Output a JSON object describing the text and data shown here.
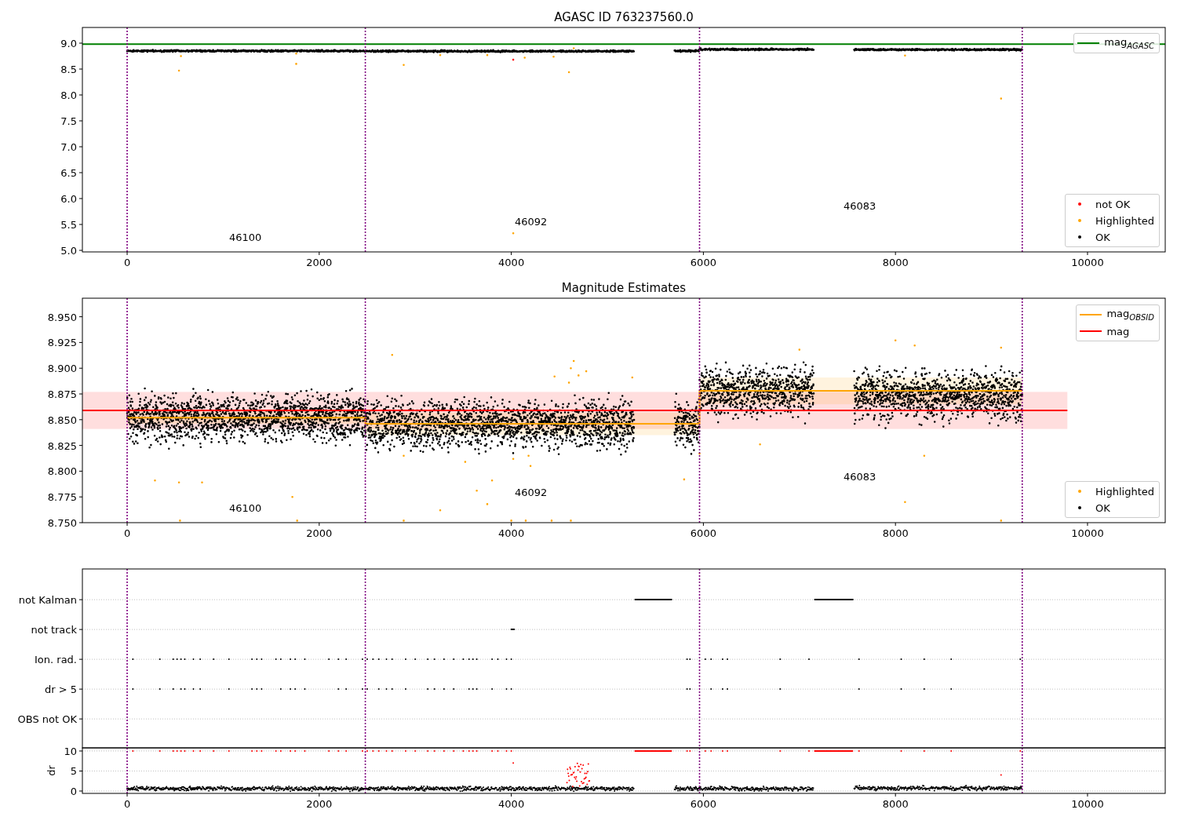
{
  "figure": {
    "panels": [
      {
        "kind": "mag",
        "chart_data": {
          "type": "line",
          "title": "AGASC ID 763237560.0",
          "x": [
            -466,
            10809
          ],
          "xlim": [
            -466,
            10809
          ],
          "ylim": [
            4.97,
            9.303
          ],
          "xticks": [
            0,
            2000,
            4000,
            6000,
            8000,
            10000
          ],
          "yticks": [
            {
              "value": 5,
              "label": "5.0"
            },
            {
              "value": 5.5,
              "label": "5.5"
            },
            {
              "value": 6,
              "label": "6.0"
            },
            {
              "value": 6.5,
              "label": "6.5"
            },
            {
              "value": 7,
              "label": "7.0"
            },
            {
              "value": 7.5,
              "label": "7.5"
            },
            {
              "value": 8,
              "label": "8.0"
            },
            {
              "value": 8.5,
              "label": "8.5"
            },
            {
              "value": 9,
              "label": "9.0"
            }
          ],
          "series": [
            {
              "name": "mag$_{AGASC}$",
              "color": "#008000",
              "values": [
                8.98,
                8.98
              ]
            }
          ],
          "ref_lines": [
            {
              "axis": "x",
              "value": 0
            },
            {
              "axis": "x",
              "value": 2480
            },
            {
              "axis": "x",
              "value": 5960
            },
            {
              "axis": "x",
              "value": 9320
            }
          ],
          "annotations": [
            {
              "text": "46100"
            },
            {
              "text": "46092"
            },
            {
              "text": "46083"
            }
          ]
        },
        "legends": [
          {
            "entries": [
              {
                "label": "not OK",
                "kind": "dot",
                "color": "#ff0000"
              },
              {
                "label": "Highlighted",
                "kind": "dot",
                "color": "#ffa500"
              },
              {
                "label": "OK",
                "kind": "dot",
                "color": "#000000"
              }
            ]
          }
        ]
      },
      {
        "kind": "mag",
        "chart_data": {
          "type": "line",
          "title": "Magnitude Estimates",
          "x": [
            -466,
            0,
            2480,
            2480,
            5960,
            5960,
            9320,
            9790
          ],
          "xlim": [
            -466,
            10809
          ],
          "ylim": [
            8.75,
            8.968
          ],
          "xticks": [
            0,
            2000,
            4000,
            6000,
            8000,
            10000
          ],
          "yticks": [
            {
              "value": 8.75,
              "label": "8.750"
            },
            {
              "value": 8.775,
              "label": "8.775"
            },
            {
              "value": 8.8,
              "label": "8.800"
            },
            {
              "value": 8.825,
              "label": "8.825"
            },
            {
              "value": 8.85,
              "label": "8.850"
            },
            {
              "value": 8.875,
              "label": "8.875"
            },
            {
              "value": 8.9,
              "label": "8.900"
            },
            {
              "value": 8.925,
              "label": "8.925"
            },
            {
              "value": 8.95,
              "label": "8.950"
            }
          ],
          "series": [
            {
              "name": "mag$_{OBSID}$",
              "color": "#ffa500",
              "values": [
                null,
                8.852,
                8.852,
                8.846,
                8.846,
                8.878,
                8.878,
                null
              ]
            },
            {
              "name": "mag",
              "color": "#ff0000",
              "values": [
                8.859,
                8.859,
                8.859,
                8.859,
                8.859,
                8.859,
                8.859,
                8.859
              ]
            }
          ],
          "bands": [
            {
              "axis": "y",
              "from": 8.841,
              "to": 8.877,
              "color": "#ff0000"
            },
            {
              "axis": "y",
              "from": 8.846,
              "to": 8.858,
              "color": "#ffa500"
            },
            {
              "axis": "y",
              "from": 8.835,
              "to": 8.857,
              "color": "#ffa500"
            },
            {
              "axis": "y",
              "from": 8.865,
              "to": 8.891,
              "color": "#ffa500"
            }
          ],
          "ref_lines": [
            {
              "axis": "x",
              "value": 0
            },
            {
              "axis": "x",
              "value": 2480
            },
            {
              "axis": "x",
              "value": 5960
            },
            {
              "axis": "x",
              "value": 9320
            }
          ],
          "annotations": [
            {
              "text": "46100"
            },
            {
              "text": "46092"
            },
            {
              "text": "46083"
            }
          ]
        },
        "legends": [
          {
            "entries": [
              {
                "label": "Highlighted",
                "kind": "dot",
                "color": "#ffa500"
              },
              {
                "label": "OK",
                "kind": "dot",
                "color": "#000000"
              }
            ]
          }
        ]
      },
      {
        "kind": "flags",
        "chart_data": {
          "type": "scatter",
          "orientation": "horizontal",
          "xlim": [
            -466,
            10809
          ],
          "grid": true,
          "categories": [
            "not Kalman",
            "not track",
            "Ion. rad.",
            "dr > 5",
            "OBS not OK"
          ],
          "ref_lines": [
            {
              "axis": "x",
              "value": 0
            },
            {
              "axis": "x",
              "value": 2480
            },
            {
              "axis": "x",
              "value": 5960
            },
            {
              "axis": "x",
              "value": 9320
            }
          ]
        }
      },
      {
        "kind": "dr",
        "chart_data": {
          "type": "scatter",
          "ylabel": "dr",
          "xlim": [
            -466,
            10809
          ],
          "ylim": [
            -0.59,
            10.78
          ],
          "grid": true,
          "xticks": [
            0,
            2000,
            4000,
            6000,
            8000,
            10000
          ],
          "yticks": [
            0,
            5,
            10
          ],
          "ref_lines": [
            {
              "axis": "x",
              "value": 0
            },
            {
              "axis": "x",
              "value": 2480
            },
            {
              "axis": "x",
              "value": 5960
            },
            {
              "axis": "x",
              "value": 9320
            }
          ]
        }
      }
    ]
  }
}
